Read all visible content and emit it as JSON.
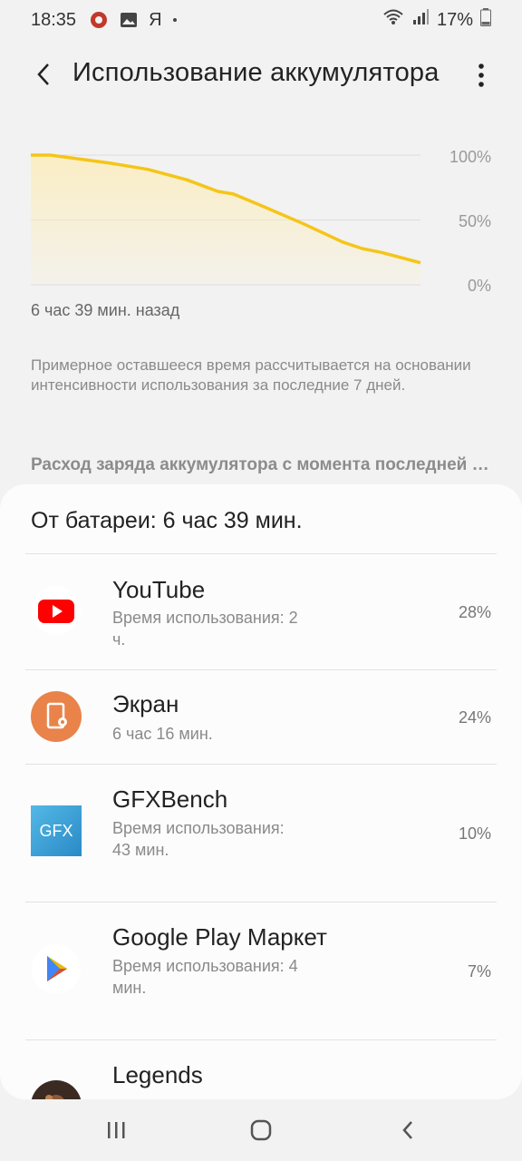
{
  "status_bar": {
    "time": "18:35",
    "carrier_label": "Я",
    "battery_percent": "17%",
    "icons": [
      "antutu-icon",
      "gallery-icon",
      "wifi-icon",
      "signal-icon",
      "battery-icon"
    ]
  },
  "header": {
    "title": "Использование аккумулятора"
  },
  "chart_data": {
    "type": "area",
    "x_label": "6 час 39 мин. назад",
    "y_ticks": [
      "100%",
      "50%",
      "0%"
    ],
    "ylim": [
      0,
      100
    ],
    "x": [
      0,
      0.05,
      0.1,
      0.2,
      0.3,
      0.4,
      0.48,
      0.52,
      0.6,
      0.7,
      0.8,
      0.85,
      0.9,
      0.95,
      1.0
    ],
    "values": [
      100,
      100,
      98,
      94,
      89,
      81,
      72,
      70,
      60,
      47,
      33,
      28,
      25,
      21,
      17
    ],
    "line_color": "#f5c518",
    "fill_color": "#fbeec2"
  },
  "note": "Примерное оставшееся время рассчитывается на основании интенсивности использования за последние 7 дней.",
  "section_header": "Расход заряда аккумулятора с момента последней полной зарядки",
  "card": {
    "title": "От батареи: 6 час 39 мин.",
    "apps": [
      {
        "name": "YouTube",
        "sub": "Время использования: 2 ч.",
        "percent": "28%",
        "icon": "youtube-icon"
      },
      {
        "name": "Экран",
        "sub": "6 час 16 мин.",
        "percent": "24%",
        "icon": "screen-icon"
      },
      {
        "name": "GFXBench",
        "sub": "Время использования: 43 мин.",
        "percent": "10%",
        "icon": "gfxbench-icon",
        "icon_text": "GFX"
      },
      {
        "name": "Google Play Маркет",
        "sub": "Время использования: 4 мин.",
        "percent": "7%",
        "icon": "google-play-icon"
      },
      {
        "name": "Legends",
        "sub": "",
        "percent": "",
        "icon": "legends-icon"
      }
    ]
  },
  "colors": {
    "accent_yellow": "#f5c518",
    "youtube_red": "#ff0000",
    "screen_orange": "#e9834a",
    "gfx_blue": "#3aa0d8"
  }
}
